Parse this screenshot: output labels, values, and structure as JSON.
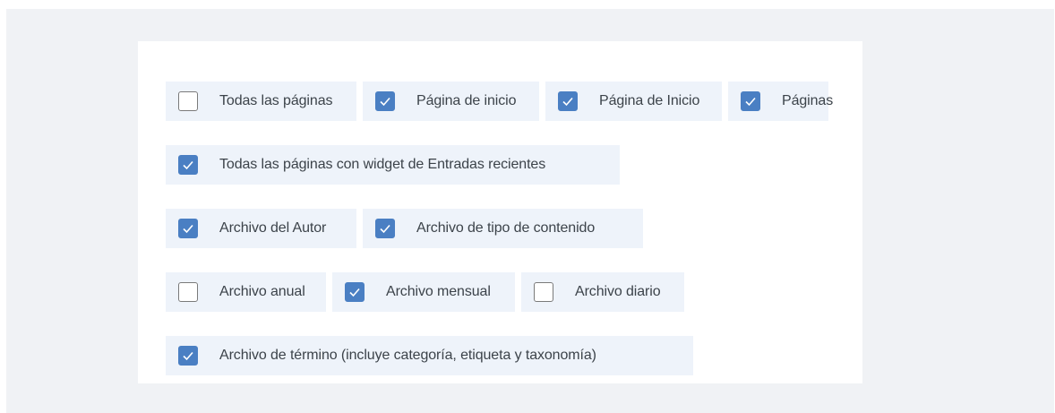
{
  "rows": [
    [
      {
        "label": "Todas las páginas",
        "checked": false
      },
      {
        "label": "Página de inicio",
        "checked": true
      },
      {
        "label": "Página de Inicio",
        "checked": true
      },
      {
        "label": "Páginas",
        "checked": true
      }
    ],
    [
      {
        "label": "Todas las páginas con widget de Entradas recientes",
        "checked": true
      }
    ],
    [
      {
        "label": "Archivo del Autor",
        "checked": true
      },
      {
        "label": "Archivo de tipo de contenido",
        "checked": true
      }
    ],
    [
      {
        "label": "Archivo anual",
        "checked": false
      },
      {
        "label": "Archivo mensual",
        "checked": true
      },
      {
        "label": "Archivo diario",
        "checked": false
      }
    ],
    [
      {
        "label": "Archivo de término (incluye categoría, etiqueta y taxonomía)",
        "checked": true
      }
    ]
  ],
  "colors": {
    "checked": "#4a7fc3",
    "option_bg": "#eef3fa",
    "page_bg": "#f0f2f5"
  }
}
